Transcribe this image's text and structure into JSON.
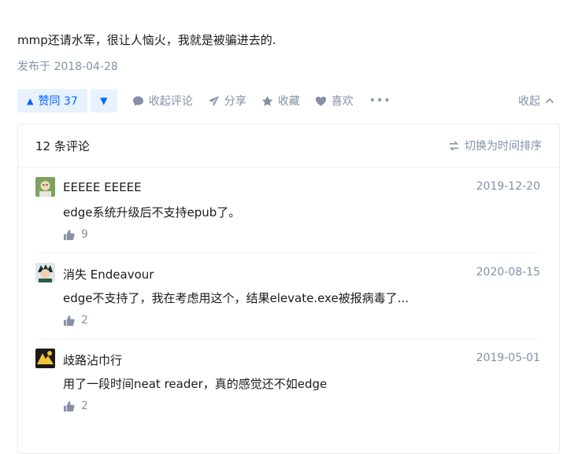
{
  "answer": {
    "text": "mmp还请水军，很让人恼火，我就是被骗进去的.",
    "date": "发布于 2018-04-28"
  },
  "actions": {
    "vote_up": "赞同 37",
    "comment": "收起评论",
    "share": "分享",
    "favorite": "收藏",
    "like": "喜欢",
    "more": "•••",
    "collapse": "收起"
  },
  "comments": {
    "count_label": "12 条评论",
    "sort_label": "切换为时间排序",
    "items": [
      {
        "author": "EEEEE EEEEE",
        "date": "2019-12-20",
        "text": "edge系统升级后不支持epub了。",
        "likes": "9"
      },
      {
        "author": "消失 Endeavour",
        "date": "2020-08-15",
        "text": "edge不支持了，我在考虑用这个，结果elevate.exe被报病毒了...",
        "likes": "2"
      },
      {
        "author": "歧路沾巾行",
        "date": "2019-05-01",
        "text": "用了一段时间neat reader，真的感觉还不如edge",
        "likes": "2"
      }
    ]
  },
  "colors": {
    "accent": "#0066ff",
    "accent_bg": "#e8f1ff",
    "meta": "#8590a6"
  }
}
